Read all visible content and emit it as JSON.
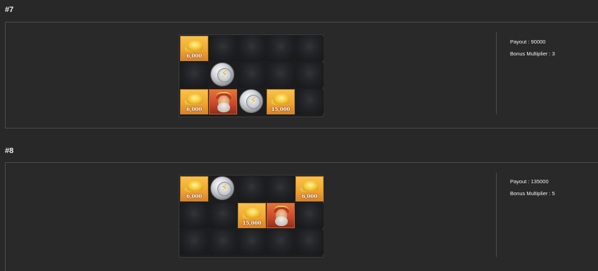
{
  "rounds": [
    {
      "title": "#7",
      "payout_label": "Payout : 90000",
      "bonus_label": "Bonus Multiplier : 3",
      "grid": [
        [
          {
            "type": "gold",
            "value": "6,000"
          },
          {
            "type": "blank"
          },
          {
            "type": "blank"
          },
          {
            "type": "blank"
          },
          {
            "type": "blank"
          }
        ],
        [
          {
            "type": "blank"
          },
          {
            "type": "coin"
          },
          {
            "type": "blank"
          },
          {
            "type": "blank"
          },
          {
            "type": "blank"
          }
        ],
        [
          {
            "type": "gold",
            "value": "6,000"
          },
          {
            "type": "hero"
          },
          {
            "type": "coin"
          },
          {
            "type": "gold",
            "value": "15,000"
          },
          {
            "type": "blank"
          }
        ]
      ]
    },
    {
      "title": "#8",
      "payout_label": "Payout : 135000",
      "bonus_label": "Bonus Multiplier : 5",
      "grid": [
        [
          {
            "type": "gold",
            "value": "6,000"
          },
          {
            "type": "coin"
          },
          {
            "type": "blank"
          },
          {
            "type": "blank"
          },
          {
            "type": "gold",
            "value": "6,000"
          }
        ],
        [
          {
            "type": "blank"
          },
          {
            "type": "blank"
          },
          {
            "type": "gold",
            "value": "15,000"
          },
          {
            "type": "hero"
          },
          {
            "type": "blank"
          }
        ],
        [
          {
            "type": "blank"
          },
          {
            "type": "blank"
          },
          {
            "type": "blank"
          },
          {
            "type": "blank"
          },
          {
            "type": "blank"
          }
        ]
      ]
    }
  ]
}
